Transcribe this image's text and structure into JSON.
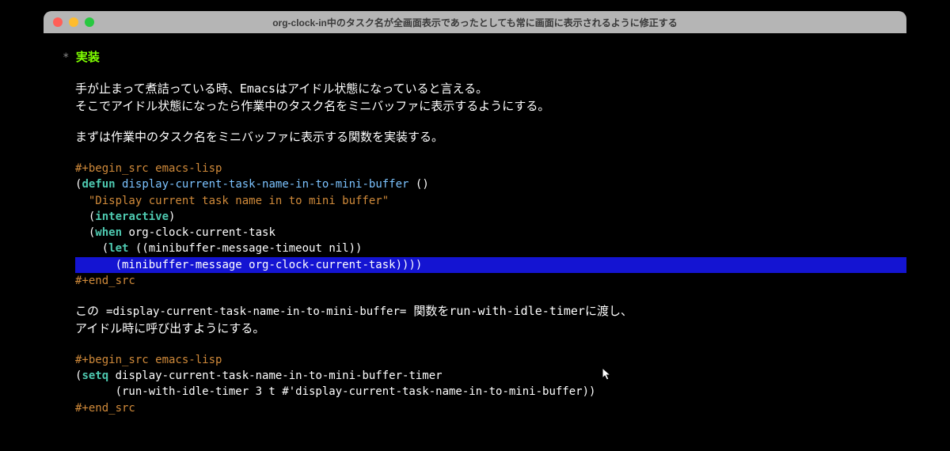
{
  "window": {
    "title": "org-clock-in中のタスク名が全画面表示であったとしても常に画面に表示されるように修正する"
  },
  "heading": {
    "star": "*",
    "text": "実装"
  },
  "paragraphs": {
    "p1": "手が止まって煮詰っている時、Emacsはアイドル状態になっていると言える。",
    "p2": "そこでアイドル状態になったら作業中のタスク名をミニバッファに表示するようにする。",
    "p3": "まずは作業中のタスク名をミニバッファに表示する関数を実装する。",
    "p4_a": "この ",
    "p4_code": "=display-current-task-name-in-to-mini-buffer=",
    "p4_b": " 関数をrun-with-idle-timerに渡し、",
    "p5": "アイドル時に呼び出すようにする。"
  },
  "code1": {
    "begin": "#+begin_src emacs-lisp",
    "l1_open": "(",
    "l1_defun": "defun",
    "l1_sp": " ",
    "l1_name": "display-current-task-name-in-to-mini-buffer",
    "l1_args": " ()",
    "l2_indent": "  ",
    "l2_doc": "\"Display current task name in to mini buffer\"",
    "l3_indent": "  (",
    "l3_interactive": "interactive",
    "l3_close": ")",
    "l4_indent": "  (",
    "l4_when": "when",
    "l4_rest": " org-clock-current-task",
    "l5_indent": "    (",
    "l5_let": "let",
    "l5_rest": " ((minibuffer-message-timeout nil))",
    "l6_indent": "      ",
    "l6_rest": "(minibuffer-message org-clock-current-task))))",
    "end": "#+end_src"
  },
  "code2": {
    "begin": "#+begin_src emacs-lisp",
    "l1_open": "(",
    "l1_setq": "setq",
    "l1_rest": " display-current-task-name-in-to-mini-buffer-timer",
    "l2": "      (run-with-idle-timer 3 t #'display-current-task-name-in-to-mini-buffer))",
    "end": "#+end_src"
  }
}
